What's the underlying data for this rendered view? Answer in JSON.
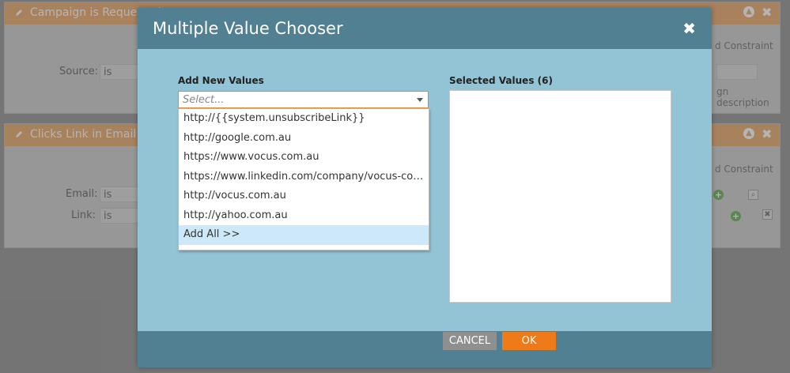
{
  "background": {
    "panel1": {
      "title": "Campaign is Requested",
      "source_label": "Source:",
      "source_value": "is",
      "add_constraint": "d Constraint",
      "right_text": "gn description"
    },
    "panel2": {
      "title": "Clicks Link in Email",
      "email_label": "Email:",
      "email_value": "is",
      "link_label": "Link:",
      "link_value": "is",
      "add_constraint": "d Constraint"
    }
  },
  "modal": {
    "title": "Multiple Value Chooser",
    "close_glyph": "✖",
    "add_new_label": "Add New Values",
    "selected_label": "Selected Values (6)",
    "select_placeholder": "Select...",
    "options": [
      "http://{{system.unsubscribeLink}}",
      "http://google.com.au",
      "https://www.vocus.com.au",
      "https://www.linkedin.com/company/vocus-communications",
      "http://vocus.com.au",
      "http://yahoo.com.au"
    ],
    "add_all_label": "Add All >>",
    "cancel_label": "CANCEL",
    "ok_label": "OK"
  }
}
